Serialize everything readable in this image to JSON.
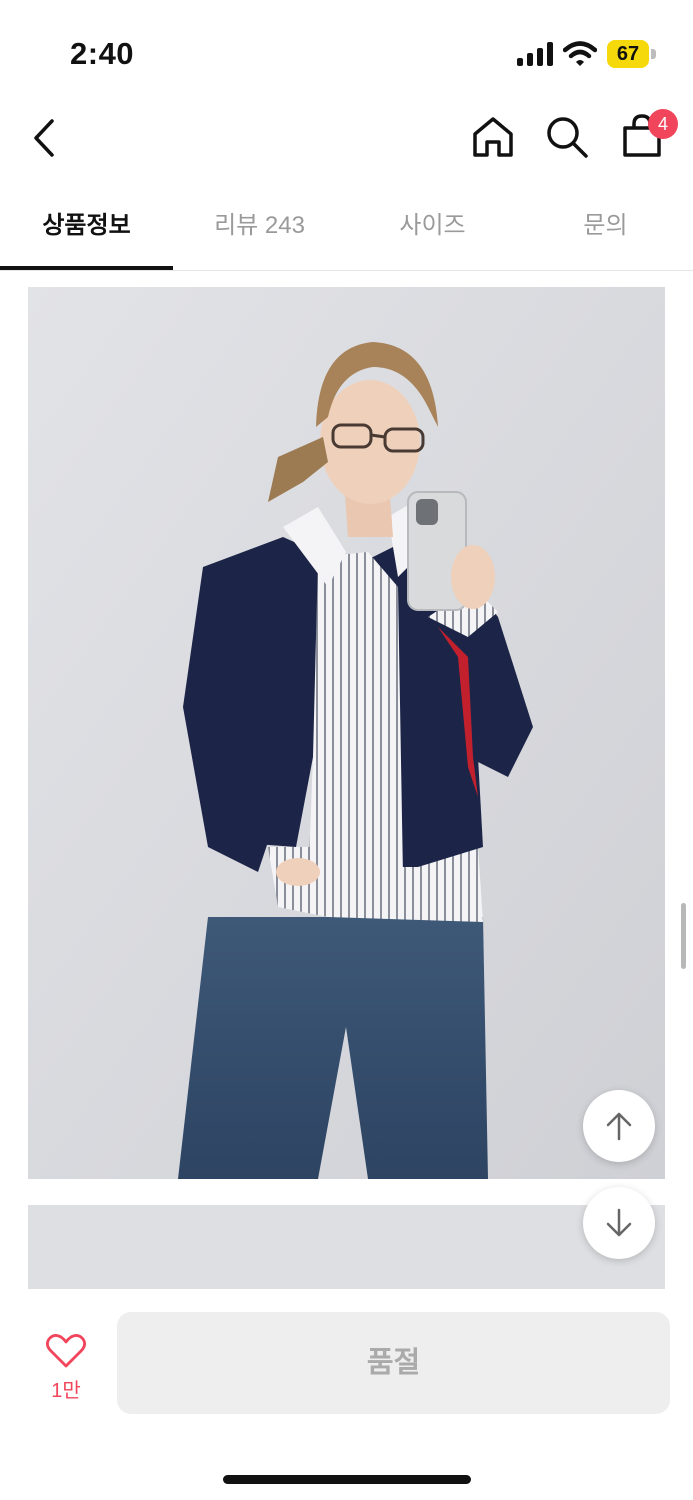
{
  "status_bar": {
    "time": "2:40",
    "battery_level": "67",
    "battery_color": "#f5d90a"
  },
  "header": {
    "icons": [
      "back-icon",
      "home-icon",
      "search-icon",
      "shopping-bag-icon"
    ],
    "cart_count": "4",
    "badge_color": "#f1455b"
  },
  "tabs": [
    {
      "label": "상품정보",
      "active": true
    },
    {
      "label": "리뷰 243",
      "active": false
    },
    {
      "label": "사이즈",
      "active": false
    },
    {
      "label": "문의",
      "active": false
    }
  ],
  "floating_buttons": {
    "icons": [
      "arrow-up-icon",
      "arrow-down-icon"
    ]
  },
  "bottom_bar": {
    "like_icon": "heart-outline-icon",
    "like_count": "1만",
    "buy_button_label": "품절",
    "accent_color": "#f1455b"
  }
}
